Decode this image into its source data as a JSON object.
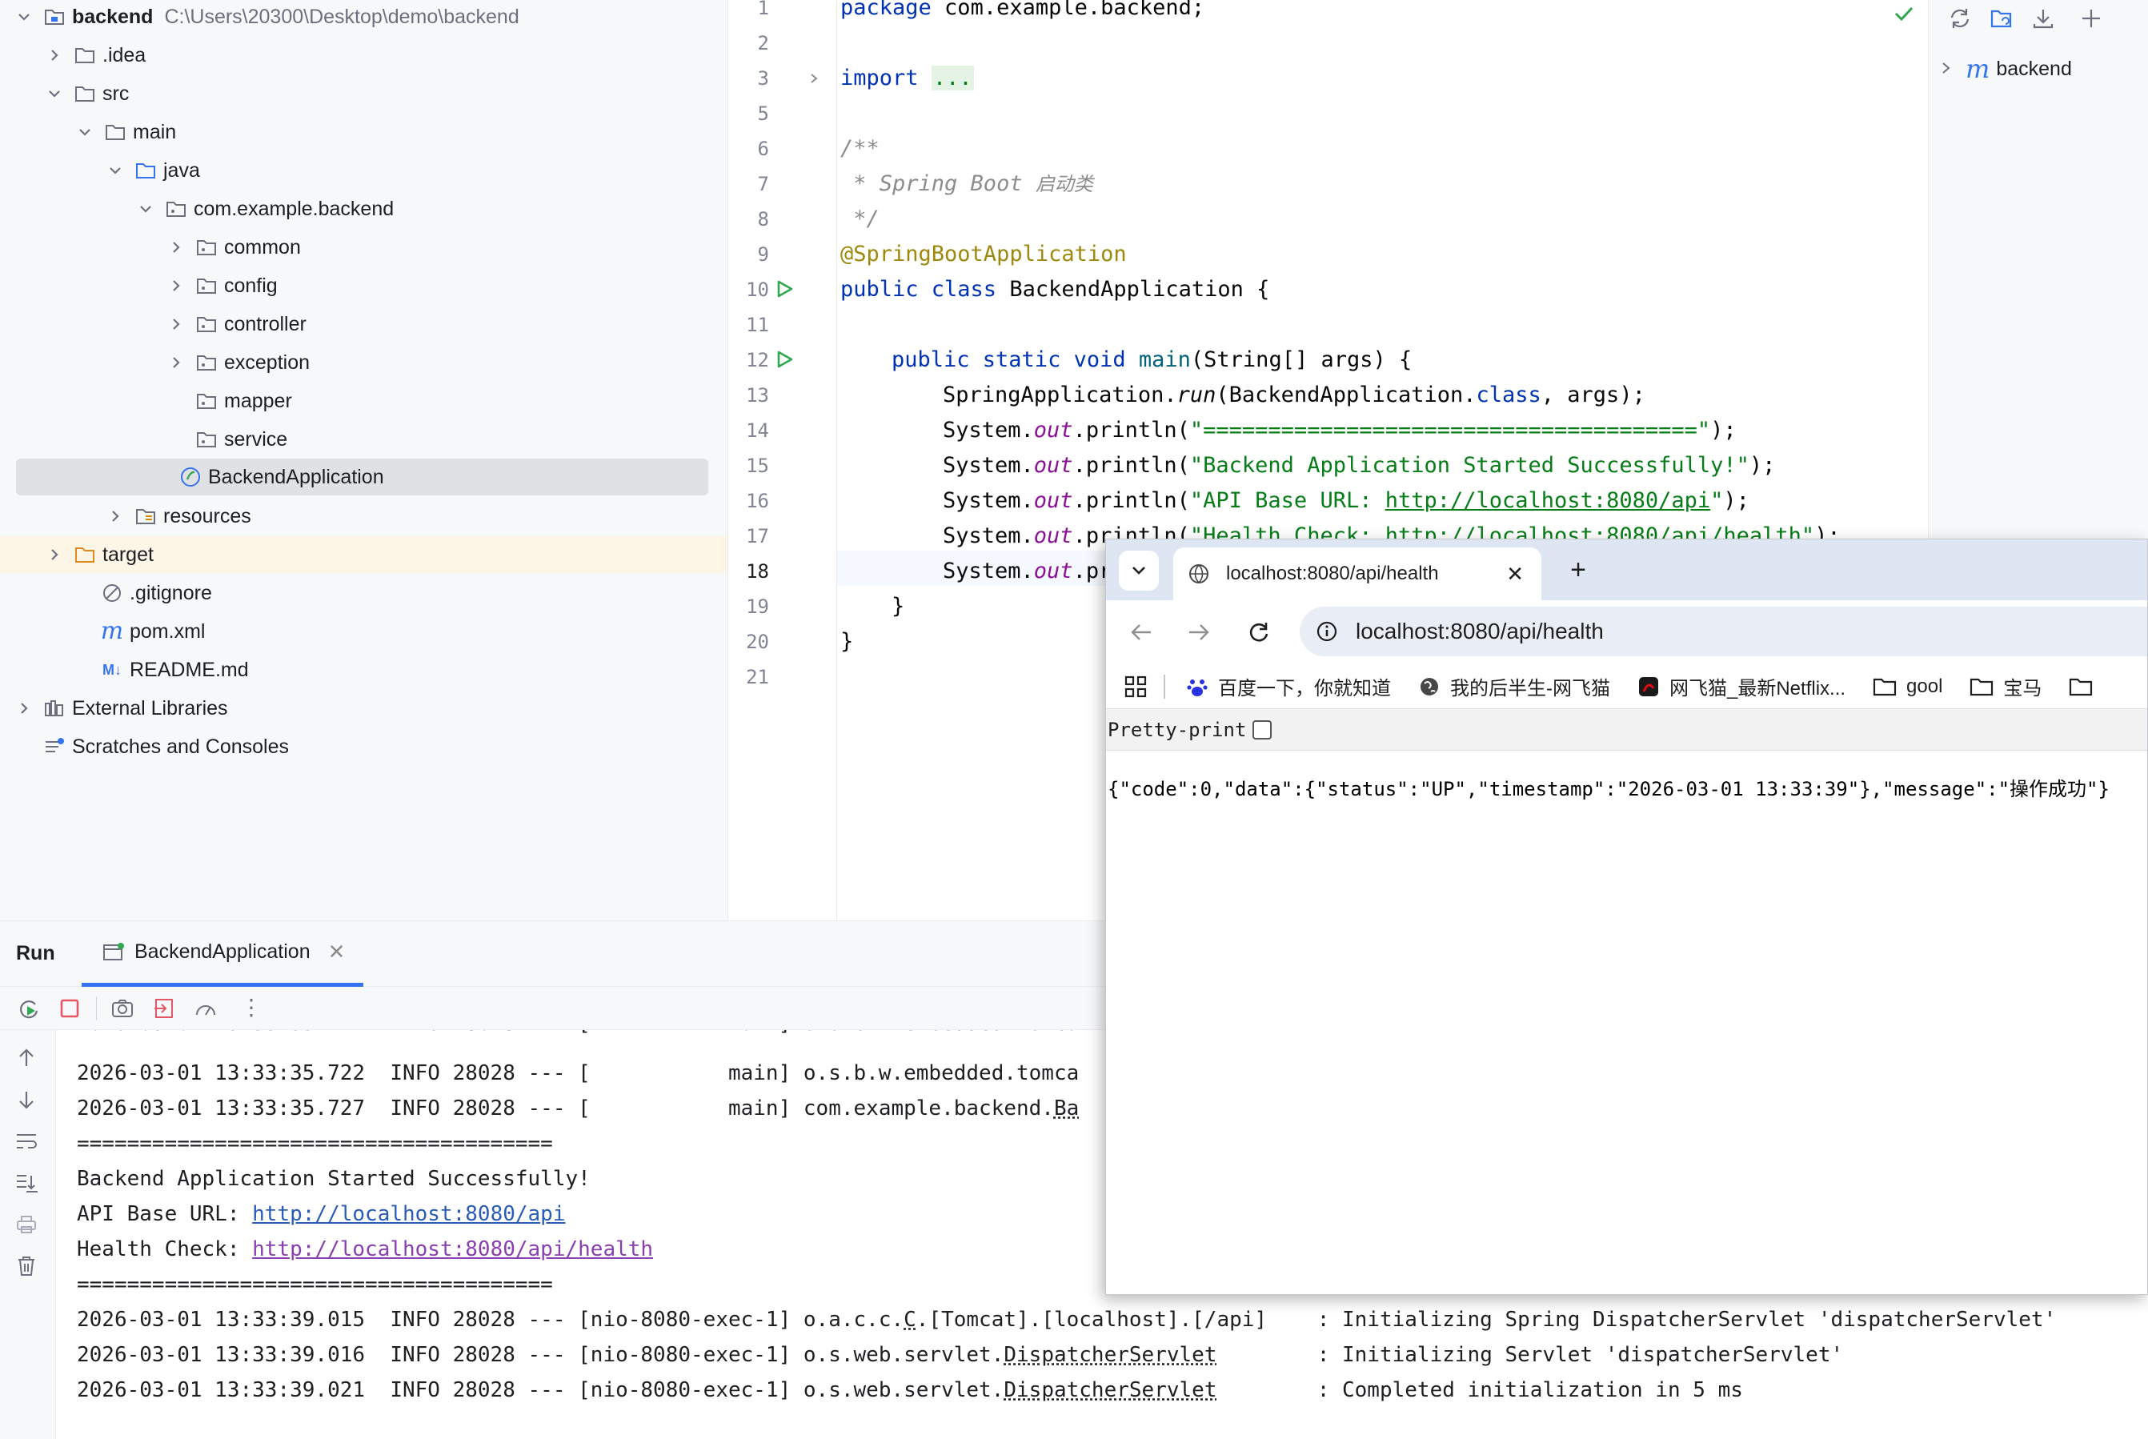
{
  "project": {
    "root_name": "backend",
    "root_path": "C:\\Users\\20300\\Desktop\\demo\\backend",
    "items": [
      {
        "label": "backend",
        "path": "C:\\Users\\20300\\Desktop\\demo\\backend",
        "type": "root-folder",
        "expanded": true
      },
      {
        "label": ".idea",
        "type": "folder",
        "expanded": false
      },
      {
        "label": "src",
        "type": "folder",
        "expanded": true
      },
      {
        "label": "main",
        "type": "folder",
        "expanded": true
      },
      {
        "label": "java",
        "type": "source-folder",
        "expanded": true
      },
      {
        "label": "com.example.backend",
        "type": "package",
        "expanded": true
      },
      {
        "label": "common",
        "type": "package",
        "expanded": false
      },
      {
        "label": "config",
        "type": "package",
        "expanded": false
      },
      {
        "label": "controller",
        "type": "package",
        "expanded": false
      },
      {
        "label": "exception",
        "type": "package",
        "expanded": false
      },
      {
        "label": "mapper",
        "type": "package"
      },
      {
        "label": "service",
        "type": "package"
      },
      {
        "label": "BackendApplication",
        "type": "spring-class",
        "selected": true
      },
      {
        "label": "resources",
        "type": "resources-folder",
        "expanded": false
      },
      {
        "label": "target",
        "type": "excluded-folder",
        "expanded": false
      },
      {
        "label": ".gitignore",
        "type": "ignore-file"
      },
      {
        "label": "pom.xml",
        "type": "maven-file"
      },
      {
        "label": "README.md",
        "type": "markdown-file"
      },
      {
        "label": "External Libraries",
        "type": "libraries",
        "expanded": false
      },
      {
        "label": "Scratches and Consoles",
        "type": "scratches"
      }
    ]
  },
  "editor": {
    "line_numbers": [
      "1",
      "2",
      "3",
      "5",
      "6",
      "7",
      "8",
      "9",
      "10",
      "11",
      "12",
      "13",
      "14",
      "15",
      "16",
      "17",
      "18",
      "19",
      "20",
      "21"
    ],
    "current_line": "18",
    "code": {
      "l1_kw": "package",
      "l1_rest": " com.example.backend;",
      "l3_kw": "import",
      "l3_fold": "...",
      "l6": "/**",
      "l7_a": " * Spring Boot ",
      "l7_b": "启动类",
      "l8": " */",
      "l9": "@SpringBootApplication",
      "l10_kw": "public class",
      "l10_rest": " BackendApplication {",
      "l12_kw": "public static void",
      "l12_m": "main",
      "l12_rest": "(String[] args) {",
      "l13_a": "SpringApplication.",
      "l13_b": "run",
      "l13_c": "(BackendApplication.",
      "l13_d": "class",
      "l13_e": ", args);",
      "sys": "System.",
      "out": "out",
      "println": ".println(",
      "l14_str": "\"======================================\"",
      "l15_str": "\"Backend Application Started Successfully!\"",
      "l16_str1": "\"API Base URL: ",
      "l16_link": "http://localhost:8080/api",
      "l16_str2": "\"",
      "l17_str1": "\"Health Check: ",
      "l17_link": "http://localhost:8080/api/health",
      "l17_str2": "\"",
      "l18_partial": "pr",
      "end": ");",
      "brace": "}"
    }
  },
  "right_panel": {
    "maven_item": "backend"
  },
  "run": {
    "title": "Run",
    "tab_label": "BackendApplication",
    "log": {
      "l0": "2026-03-01 13:33:35.722  INFO 28028 --- [           main] o.s.b.w.embedded.tomca",
      "l1a": "2026-03-01 13:33:35.727  INFO 28028 --- [           main] com.example.backend.",
      "l1b": "Ba",
      "sep": "======================================",
      "started": "Backend Application Started Successfully!",
      "api_prefix": "API Base URL: ",
      "api_link": "http://localhost:8080/api",
      "health_prefix": "Health Check: ",
      "health_link": "http://localhost:8080/api/health",
      "t1a": "2026-03-01 13:33:39.015  INFO 28028 --- [nio-8080-exec-1] o.a.c.c.",
      "t1b": "C",
      "t1c": ".[Tomcat].[localhost].[/api]    : Initializing Spring DispatcherServlet 'dispatcherServlet'",
      "t2a": "2026-03-01 13:33:39.016  INFO 28028 --- [nio-8080-exec-1] o.s.web.servlet.",
      "t2b": "DispatcherServlet",
      "t2c": "        : Initializing Servlet 'dispatcherServlet'",
      "t3a": "2026-03-01 13:33:39.021  INFO 28028 --- [nio-8080-exec-1] o.s.web.servlet.",
      "t3b": "DispatcherServlet",
      "t3c": "        : Completed initialization in 5 ms"
    }
  },
  "browser": {
    "tab_title": "localhost:8080/api/health",
    "url": "localhost:8080/api/health",
    "bookmarks": [
      "百度一下，你就知道",
      "我的后半生-网飞猫",
      "网飞猫_最新Netflix...",
      "gool",
      "宝马"
    ],
    "pretty_print_label": "Pretty-print",
    "pretty_print_checked": false,
    "response": "{\"code\":0,\"data\":{\"status\":\"UP\",\"timestamp\":\"2026-03-01 13:33:39\"},\"message\":\"操作成功\"}"
  },
  "colors": {
    "keyword": "#0033b3",
    "annotation": "#9e880d",
    "string": "#067d17",
    "static_field": "#871094",
    "comment": "#8c8c8c",
    "run_green": "#2fa84f",
    "stop_red": "#e55765"
  }
}
